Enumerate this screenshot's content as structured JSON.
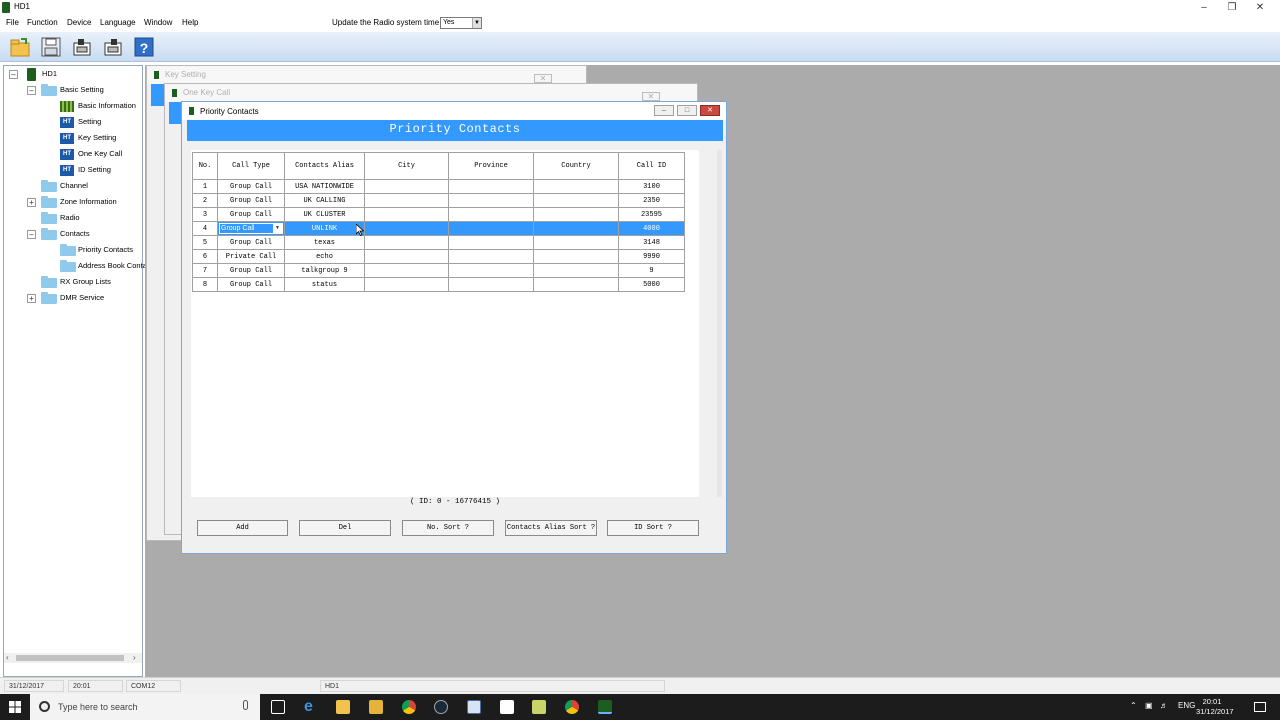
{
  "window": {
    "title": "HD1"
  },
  "menu": {
    "items": [
      "File",
      "Function",
      "Device",
      "Language",
      "Window",
      "Help"
    ]
  },
  "radio_time": {
    "label": "Update the Radio system time",
    "value": "Yes"
  },
  "toolbar": {
    "icons": [
      "open-folder-icon",
      "save-icon",
      "read-radio-icon",
      "write-radio-icon",
      "help-icon"
    ]
  },
  "tree": {
    "root": "HD1",
    "basic_setting": "Basic Setting",
    "basic_information": "Basic Information",
    "setting": "Setting",
    "key_setting": "Key Setting",
    "one_key_call": "One Key Call",
    "id_setting": "ID Setting",
    "channel": "Channel",
    "zone_information": "Zone Information",
    "radio": "Radio",
    "contacts": "Contacts",
    "priority_contacts": "Priority Contacts",
    "address_book": "Address Book Conta",
    "rx_group_lists": "RX Group Lists",
    "dmr_service": "DMR Service"
  },
  "bg_windows": {
    "key_setting": "Key Setting",
    "one_key_call": "One Key Call"
  },
  "priority_window": {
    "title": "Priority Contacts",
    "banner": "Priority Contacts",
    "columns": [
      "No.",
      "Call Type",
      "Contacts Alias",
      "City",
      "Province",
      "Country",
      "Call ID"
    ],
    "rows": [
      {
        "no": "1",
        "type": "Group Call",
        "alias": "USA NATIONWIDE",
        "city": "",
        "province": "",
        "country": "",
        "id": "3100"
      },
      {
        "no": "2",
        "type": "Group Call",
        "alias": "UK CALLING",
        "city": "",
        "province": "",
        "country": "",
        "id": "2350"
      },
      {
        "no": "3",
        "type": "Group Call",
        "alias": "UK CLUSTER",
        "city": "",
        "province": "",
        "country": "",
        "id": "23595"
      },
      {
        "no": "4",
        "type": "Group Call",
        "alias": "UNLINK",
        "city": "",
        "province": "",
        "country": "",
        "id": "4000"
      },
      {
        "no": "5",
        "type": "Group Call",
        "alias": "texas",
        "city": "",
        "province": "",
        "country": "",
        "id": "3148"
      },
      {
        "no": "6",
        "type": "Private Call",
        "alias": "echo",
        "city": "",
        "province": "",
        "country": "",
        "id": "9990"
      },
      {
        "no": "7",
        "type": "Group Call",
        "alias": "talkgroup 9",
        "city": "",
        "province": "",
        "country": "",
        "id": "9"
      },
      {
        "no": "8",
        "type": "Group Call",
        "alias": "status",
        "city": "",
        "province": "",
        "country": "",
        "id": "5000"
      }
    ],
    "selected_row": 3,
    "id_range": "( ID: 0 - 16776415 )",
    "buttons": {
      "add": "Add",
      "del": "Del",
      "no_sort": "No. Sort ?",
      "alias_sort": "Contacts Alias Sort ?",
      "id_sort": "ID Sort ?"
    }
  },
  "statusbar": {
    "date": "31/12/2017",
    "time": "20:01",
    "port": "COM12",
    "device": "HD1"
  },
  "taskbar": {
    "search_placeholder": "Type here to search",
    "lang": "ENG",
    "clock_time": "20:01",
    "clock_date": "31/12/2017"
  },
  "colors": {
    "accent": "#3399ff",
    "mdi_bg": "#ababab",
    "folder": "#8fc9ec"
  }
}
